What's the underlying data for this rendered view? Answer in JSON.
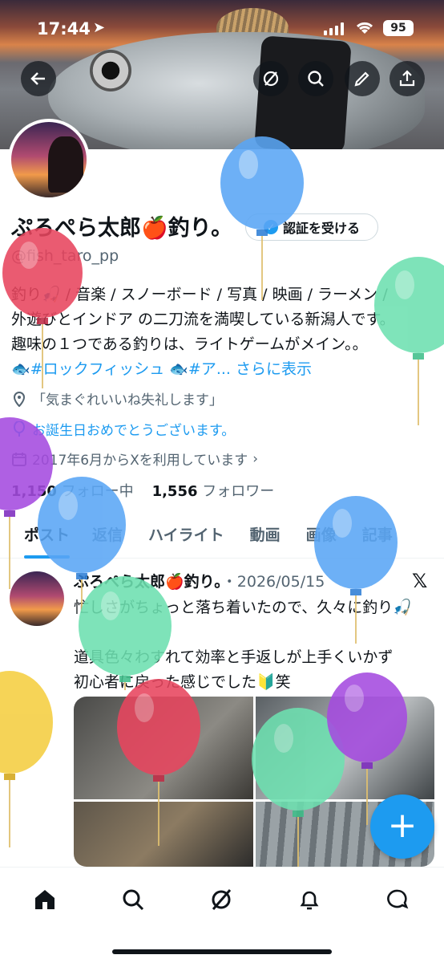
{
  "status_bar": {
    "time": "17:44",
    "battery": "95"
  },
  "profile": {
    "name": "ぷろぺら太郎🍎釣り。",
    "handle": "@fish_taro_pp",
    "verify_label": "認証を受ける",
    "bio_lines": [
      "釣り🎣 / 音楽 / スノーボード / 写真 / 映画 / ラーメン /",
      "外遊びとインドア の二刀流を満喫している新潟人です。",
      "趣味の１つである釣りは、ライトゲームがメイン。。"
    ],
    "bio_tag1": "🐟#ロックフィッシュ",
    "bio_tag2": "🐟#ア...",
    "bio_more": "さらに表示",
    "location": "「気まぐれいいね失礼します」",
    "birthday": "お誕生日おめでとうございます。",
    "joined": "2017年6月からXを利用しています",
    "following_count": "1,150",
    "following_label": "フォロー中",
    "followers_count": "1,556",
    "followers_label": "フォロワー"
  },
  "tabs": [
    "ポスト",
    "返信",
    "ハイライト",
    "動画",
    "画像",
    "記事"
  ],
  "post": {
    "author": "ぷろぺら太郎🍎釣り。",
    "date": "・2026/05/15",
    "line1": "忙しさがちょっと落ち着いたので、久々に釣り🎣",
    "line2": "道具色々わすれて効率と手返しが上手くいかず",
    "line3": "初心者に戻った感じでした🔰笑"
  },
  "icons": [
    "back-icon",
    "grok-icon",
    "search-icon",
    "edit-icon",
    "share-icon",
    "home-icon",
    "explore-icon",
    "notifications-icon",
    "messages-icon",
    "compose-icon"
  ],
  "colors": {
    "accent": "#1d9bf0",
    "text": "#0f1419",
    "muted": "#536471"
  }
}
